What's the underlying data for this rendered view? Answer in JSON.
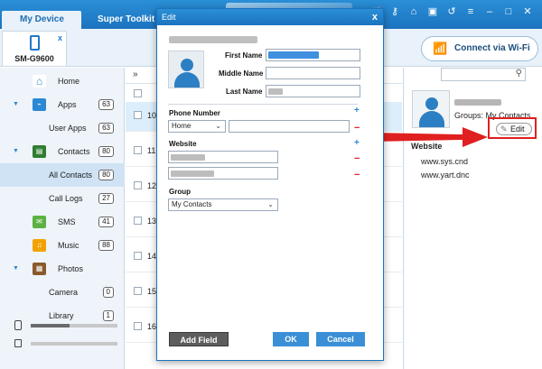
{
  "header": {
    "tab_device": "My Device",
    "tab_toolkit": "Super Toolkit",
    "icons": [
      "shop-icon",
      "key-icon",
      "home-icon",
      "gift-icon",
      "restore-icon",
      "menu-icon",
      "minimize-icon",
      "maximize-icon",
      "close-icon"
    ]
  },
  "device": {
    "name": "SM-G9600",
    "close": "x",
    "wifi_label": "Connect via Wi-Fi"
  },
  "sidebar": {
    "items": [
      {
        "label": "Home",
        "icon": "home-icon",
        "count": ""
      },
      {
        "label": "Apps",
        "icon": "apps-icon",
        "count": "63"
      },
      {
        "label": "User Apps",
        "icon": "",
        "count": "63"
      },
      {
        "label": "Contacts",
        "icon": "contacts-icon",
        "count": "80"
      },
      {
        "label": "All Contacts",
        "icon": "",
        "count": "80"
      },
      {
        "label": "Call Logs",
        "icon": "",
        "count": "27"
      },
      {
        "label": "SMS",
        "icon": "sms-icon",
        "count": "41"
      },
      {
        "label": "Music",
        "icon": "music-icon",
        "count": "88"
      },
      {
        "label": "Photos",
        "icon": "photos-icon",
        "count": ""
      },
      {
        "label": "Camera",
        "icon": "",
        "count": "0"
      },
      {
        "label": "Library",
        "icon": "",
        "count": "1"
      }
    ],
    "storage": [
      {
        "icon": "phone-storage-icon",
        "used": 0.45
      },
      {
        "icon": "sd-card-icon",
        "used": 0.0
      }
    ]
  },
  "list": {
    "toolbar_icon": "»",
    "rows": [
      "10",
      "11",
      "12",
      "13",
      "14",
      "15",
      "16"
    ]
  },
  "detail": {
    "groups": "Groups: My Contacts",
    "edit_label": "Edit",
    "website_heading": "Website",
    "sites": [
      "www.sys.cnd",
      "www.yart.dnc"
    ]
  },
  "dialog": {
    "title": "Edit",
    "close": "x",
    "first_name_label": "First Name",
    "middle_name_label": "Middle Name",
    "last_name_label": "Last Name",
    "phone_label": "Phone Number",
    "phone_type": "Home",
    "website_label": "Website",
    "group_label": "Group",
    "group_value": "My Contacts",
    "add_field": "Add Field",
    "ok": "OK",
    "cancel": "Cancel",
    "plus": "+",
    "minus": "−"
  },
  "colors": {
    "accent": "#1b73bf",
    "highlight": "#e02020"
  }
}
